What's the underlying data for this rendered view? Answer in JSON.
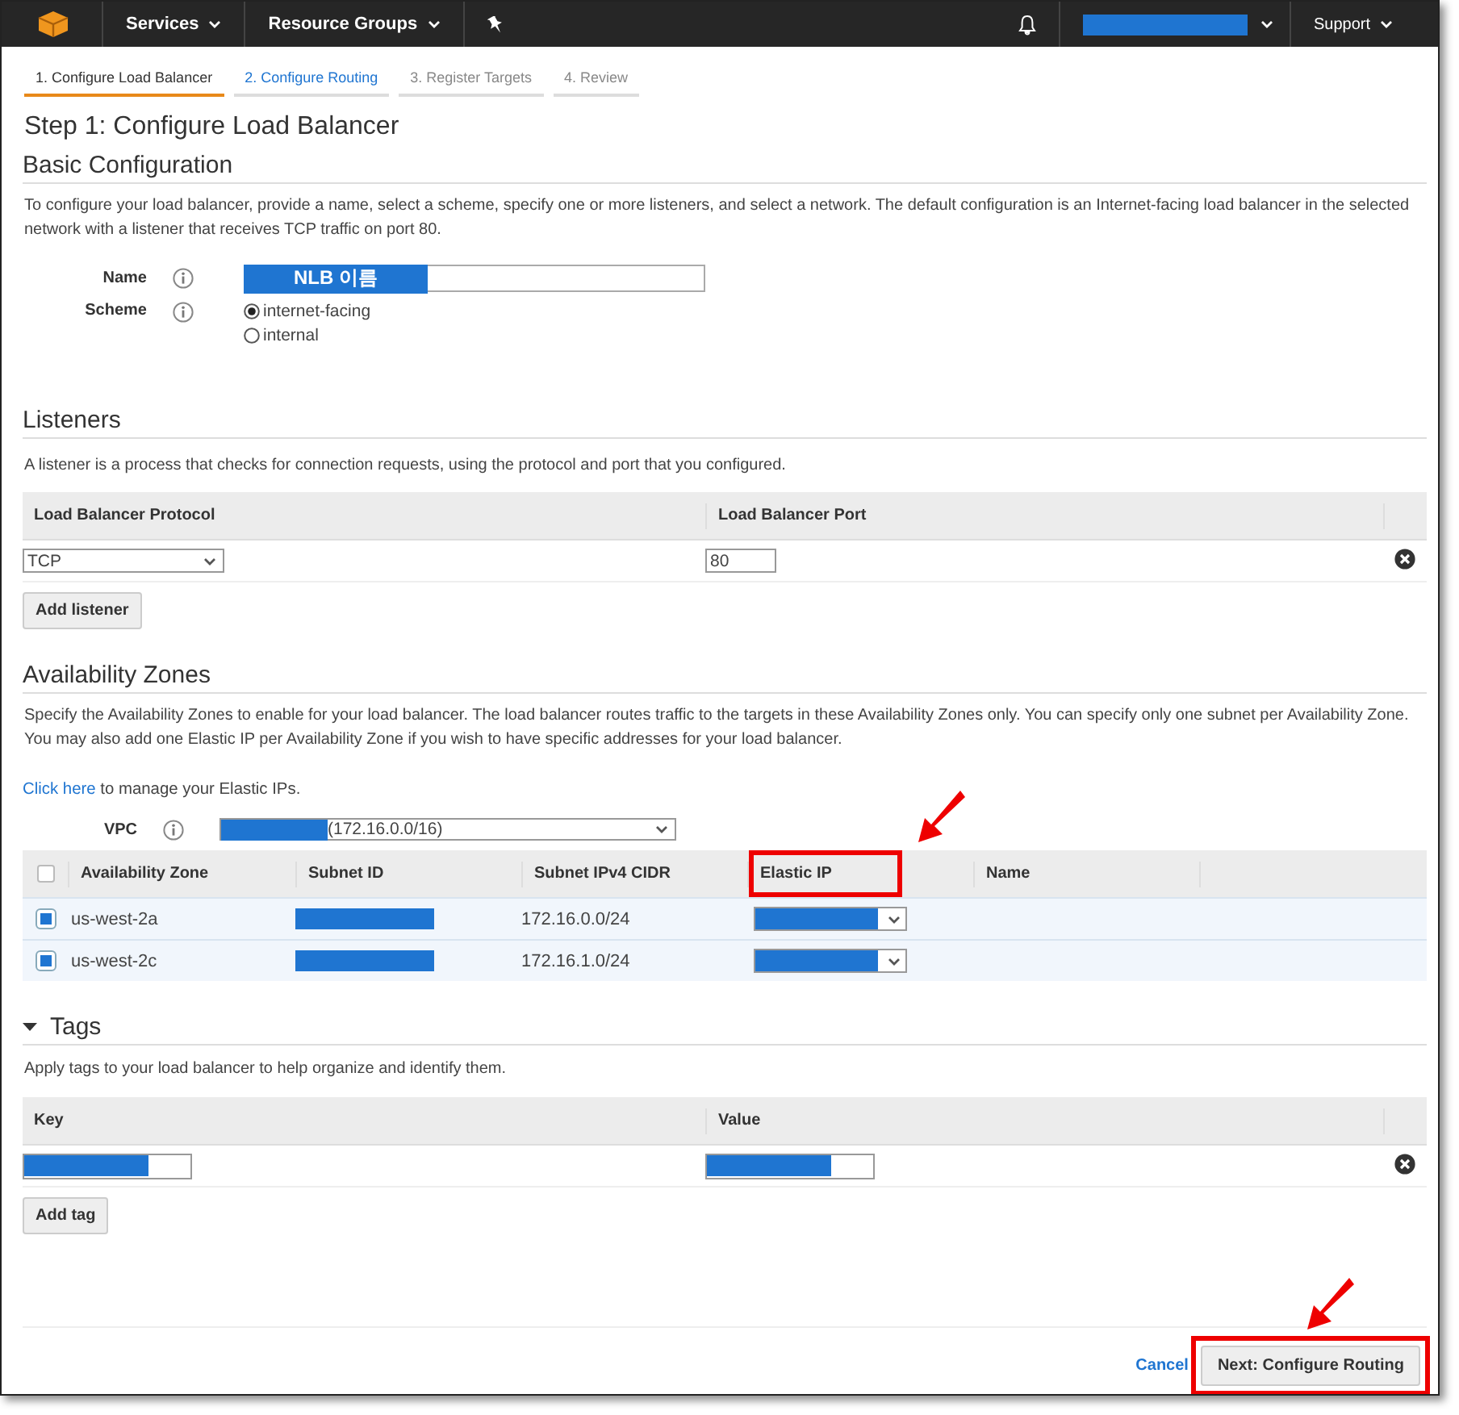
{
  "topbar": {
    "menus": [
      {
        "label": "Services"
      },
      {
        "label": "Resource Groups"
      }
    ],
    "support": "Support"
  },
  "wizard_tabs": [
    {
      "label": "1. Configure Load Balancer",
      "selected": true,
      "disabled": false
    },
    {
      "label": "2. Configure Routing",
      "selected": false,
      "disabled": false
    },
    {
      "label": "3. Register Targets",
      "selected": false,
      "disabled": true
    },
    {
      "label": "4. Review",
      "selected": false,
      "disabled": true
    }
  ],
  "title": "Step 1: Configure Load Balancer",
  "basic": {
    "heading": "Basic Configuration",
    "description": "To configure your load balancer, provide a name, select a scheme, specify one or more listeners, and select a network. The default configuration is an Internet-facing load balancer in the selected network with a listener that receives TCP traffic on port 80.",
    "name": {
      "label": "Name",
      "annotation": "NLB 이름"
    },
    "scheme": {
      "label": "Scheme",
      "options": [
        {
          "label": "internet-facing",
          "selected": true
        },
        {
          "label": "internal",
          "selected": false
        }
      ]
    }
  },
  "listeners": {
    "heading": "Listeners",
    "description": "A listener is a process that checks for connection requests, using the protocol and port that you configured.",
    "columns": [
      {
        "label": "Load Balancer Protocol"
      },
      {
        "label": "Load Balancer Port"
      }
    ],
    "rows": [
      {
        "protocol": "TCP",
        "port": "80"
      }
    ],
    "add_button": "Add listener"
  },
  "availability_zones": {
    "heading": "Availability Zones",
    "description": "Specify the Availability Zones to enable for your load balancer. The load balancer routes traffic to the targets in these Availability Zones only. You can specify only one subnet per Availability Zone. You may also add one Elastic IP per Availability Zone if you wish to have specific addresses for your load balancer.",
    "link": "Click here",
    "link_suffix": "to manage your Elastic IPs.",
    "vpc": {
      "label": "VPC",
      "value": "(172.16.0.0/16)"
    },
    "select_all": {
      "checked": false
    },
    "columns": [
      {
        "label": "Availability Zone",
        "highlighted": false
      },
      {
        "label": "Subnet ID",
        "highlighted": false
      },
      {
        "label": "Subnet IPv4 CIDR",
        "highlighted": false
      },
      {
        "label": "Elastic IP",
        "highlighted": true
      },
      {
        "label": "Name",
        "highlighted": false
      }
    ],
    "rows": [
      {
        "zone": "us-west-2a",
        "cidr": "172.16.0.0/24",
        "checked": true
      },
      {
        "zone": "us-west-2c",
        "cidr": "172.16.1.0/24",
        "checked": true
      }
    ]
  },
  "tags": {
    "heading": "Tags",
    "expanded": true,
    "description": "Apply tags to your load balancer to help organize and identify them.",
    "columns": [
      {
        "label": "Key"
      },
      {
        "label": "Value"
      }
    ],
    "add_button": "Add tag"
  },
  "footer": {
    "cancel": "Cancel",
    "next": {
      "label": "Next: Configure Routing",
      "highlighted": true
    }
  }
}
